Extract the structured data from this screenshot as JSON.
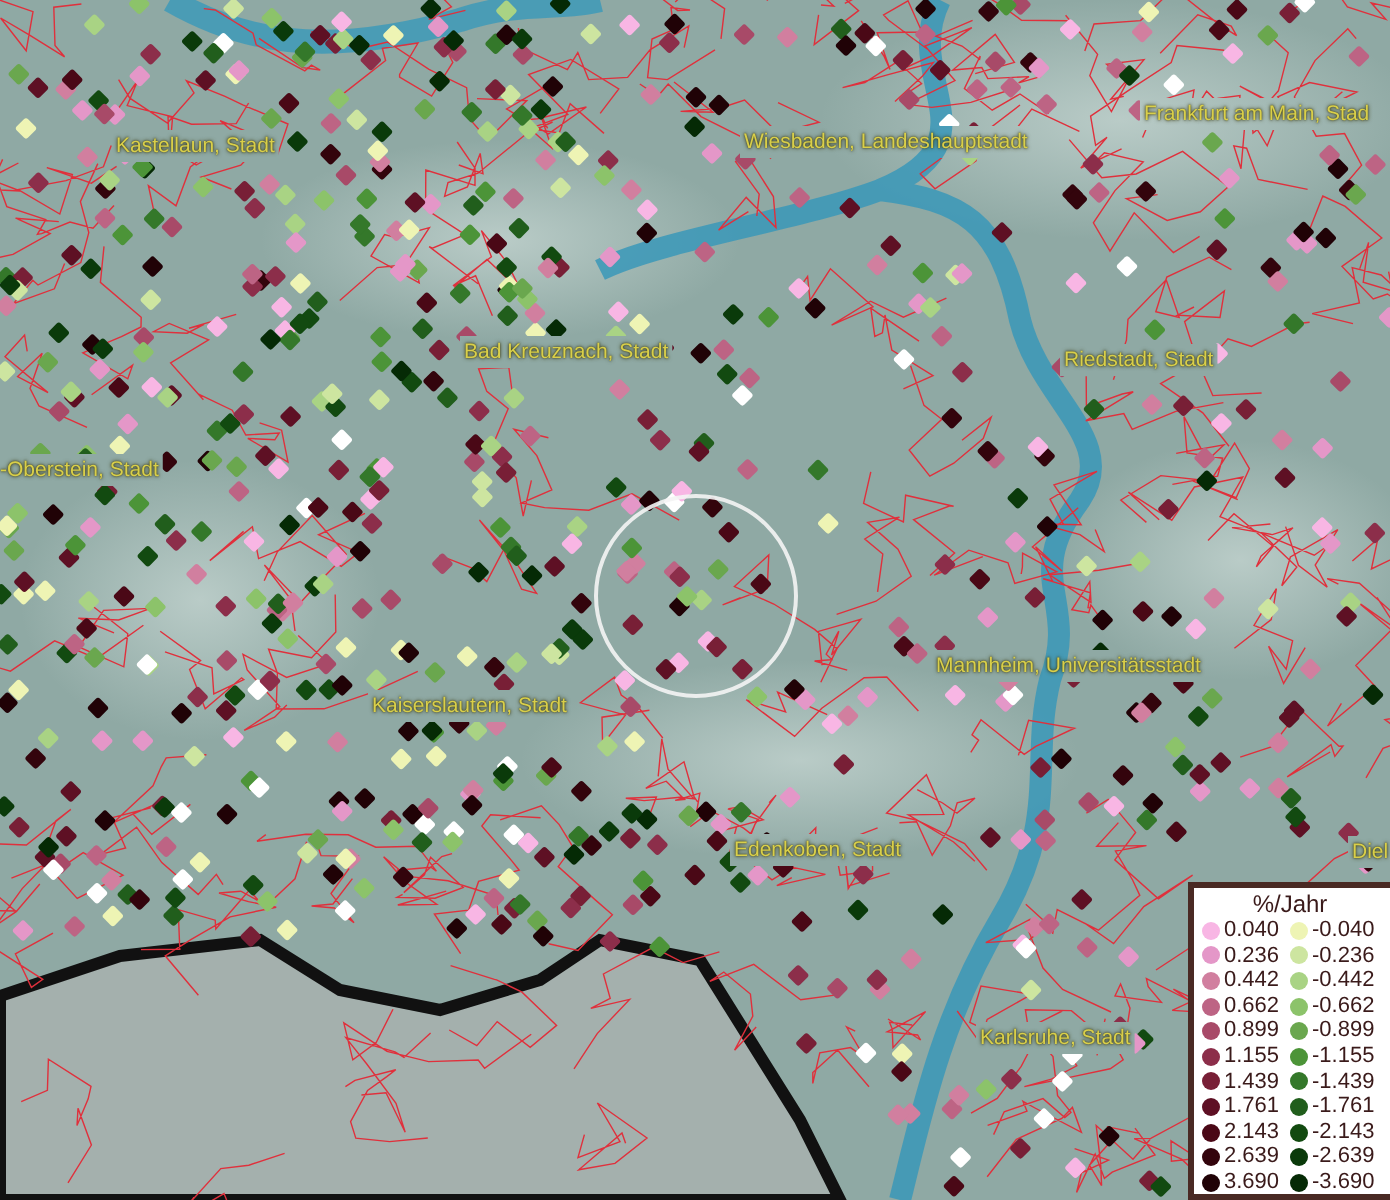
{
  "map": {
    "place_labels": [
      {
        "text": "Kastellaun, Stadt"
      },
      {
        "text": "Wiesbaden, Landeshauptstadt"
      },
      {
        "text": "Frankfurt am Main, Stad"
      },
      {
        "text": "Bad Kreuznach, Stadt"
      },
      {
        "text": "Riedstadt, Stadt"
      },
      {
        "text": "-Oberstein, Stadt"
      },
      {
        "text": "Kaiserslautern, Stadt"
      },
      {
        "text": "Mannheim, Universitätsstadt"
      },
      {
        "text": "Edenkoben, Stadt"
      },
      {
        "text": "Diel"
      },
      {
        "text": "Karlsruhe, Stadt"
      }
    ],
    "legend": {
      "title": "%/Jahr",
      "rows": [
        {
          "left": {
            "label": "0.040",
            "color": "#f8b6e4"
          },
          "right": {
            "label": "-0.040",
            "color": "#eef4b4"
          }
        },
        {
          "left": {
            "label": "0.236",
            "color": "#e497c8"
          },
          "right": {
            "label": "-0.236",
            "color": "#cde5a0"
          }
        },
        {
          "left": {
            "label": "0.442",
            "color": "#d17f9f"
          },
          "right": {
            "label": "-0.442",
            "color": "#a9d384"
          }
        },
        {
          "left": {
            "label": "0.662",
            "color": "#bd6484"
          },
          "right": {
            "label": "-0.662",
            "color": "#8cc36a"
          }
        },
        {
          "left": {
            "label": "0.899",
            "color": "#a84a68"
          },
          "right": {
            "label": "-0.899",
            "color": "#6aa74e"
          }
        },
        {
          "left": {
            "label": "1.155",
            "color": "#8c2e4a"
          },
          "right": {
            "label": "-1.155",
            "color": "#4c9438"
          }
        },
        {
          "left": {
            "label": "1.439",
            "color": "#781f36"
          },
          "right": {
            "label": "-1.439",
            "color": "#34782a"
          }
        },
        {
          "left": {
            "label": "1.761",
            "color": "#5e1024"
          },
          "right": {
            "label": "-1.761",
            "color": "#215e1c"
          }
        },
        {
          "left": {
            "label": "2.143",
            "color": "#4a0816"
          },
          "right": {
            "label": "-2.143",
            "color": "#124a10"
          }
        },
        {
          "left": {
            "label": "2.639",
            "color": "#33040c"
          },
          "right": {
            "label": "-2.639",
            "color": "#0a3a0a"
          }
        },
        {
          "left": {
            "label": "3.690",
            "color": "#200206"
          },
          "right": {
            "label": "-3.690",
            "color": "#052a05"
          }
        }
      ]
    }
  }
}
